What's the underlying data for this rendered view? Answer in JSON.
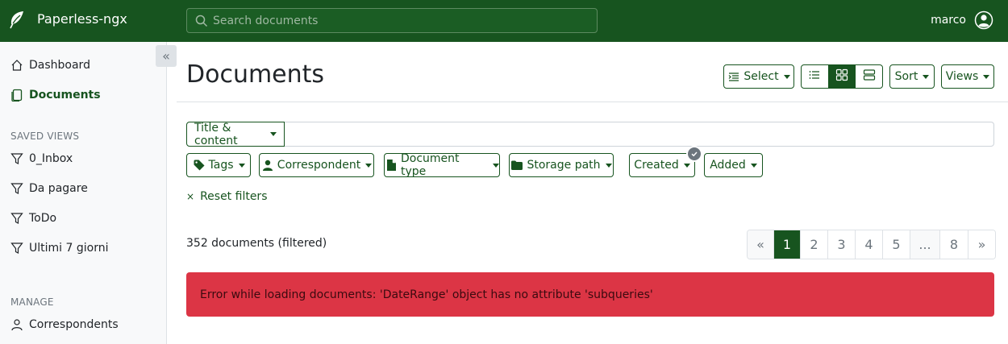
{
  "app": {
    "name": "Paperless-ngx"
  },
  "search": {
    "placeholder": "Search documents"
  },
  "user": {
    "name": "marco"
  },
  "sidebar": {
    "items": [
      {
        "label": "Dashboard",
        "icon": "house-icon"
      },
      {
        "label": "Documents",
        "icon": "documents-icon",
        "active": true
      }
    ],
    "saved_views_label": "SAVED VIEWS",
    "saved_views": [
      {
        "label": "0_Inbox",
        "icon": "funnel-icon"
      },
      {
        "label": "Da pagare",
        "icon": "funnel-icon"
      },
      {
        "label": "ToDo",
        "icon": "funnel-icon"
      },
      {
        "label": "Ultimi 7 giorni",
        "icon": "funnel-icon"
      }
    ],
    "manage_label": "MANAGE",
    "manage": [
      {
        "label": "Correspondents",
        "icon": "person-icon"
      }
    ]
  },
  "page": {
    "title": "Documents"
  },
  "toolbar": {
    "select_label": "Select",
    "view_modes": [
      "list-icon",
      "grid-icon",
      "large-cards-icon"
    ],
    "active_view_mode": 1,
    "sort_label": "Sort",
    "views_label": "Views"
  },
  "filters": {
    "text_filter_label": "Title & content",
    "text_filter_value": "",
    "tags_label": "Tags",
    "correspondent_label": "Correspondent",
    "document_type_label": "Document type",
    "storage_path_label": "Storage path",
    "created_label": "Created",
    "added_label": "Added",
    "reset_label": "Reset filters"
  },
  "results": {
    "count_text": "352 documents (filtered)"
  },
  "pagination": {
    "pages": [
      "«",
      "1",
      "2",
      "3",
      "4",
      "5",
      "...",
      "8",
      "»"
    ],
    "current": "1"
  },
  "error": {
    "message": "Error while loading documents: 'DateRange' object has no attribute 'subqueries'"
  },
  "colors": {
    "primary": "#17541f",
    "danger": "#dc3545",
    "sidebar_bg": "#f8f9fa"
  }
}
